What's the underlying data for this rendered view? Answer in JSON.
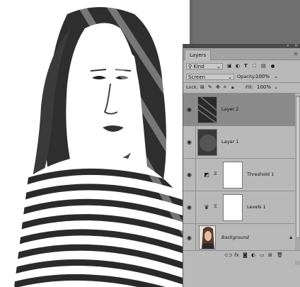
{
  "panel": {
    "tab_label": "Layers",
    "filter": {
      "kind_label": "Kind"
    },
    "blend_mode": "Screen",
    "opacity_label": "Opacity:",
    "opacity_value": "100%",
    "lock_label": "Lock:",
    "fill_label": "Fill:",
    "fill_value": "100%"
  },
  "layers": [
    {
      "name": "Layer 2",
      "selected": true
    },
    {
      "name": "Layer 1",
      "selected": false
    },
    {
      "name": "Threshold 1",
      "selected": false
    },
    {
      "name": "Levels 1",
      "selected": false
    },
    {
      "name": "Background",
      "selected": false
    }
  ],
  "colors": {
    "panel_bg": "#b9b9b9",
    "selected_row": "#8a8a8a",
    "workspace_bg": "#6f6f6f"
  }
}
